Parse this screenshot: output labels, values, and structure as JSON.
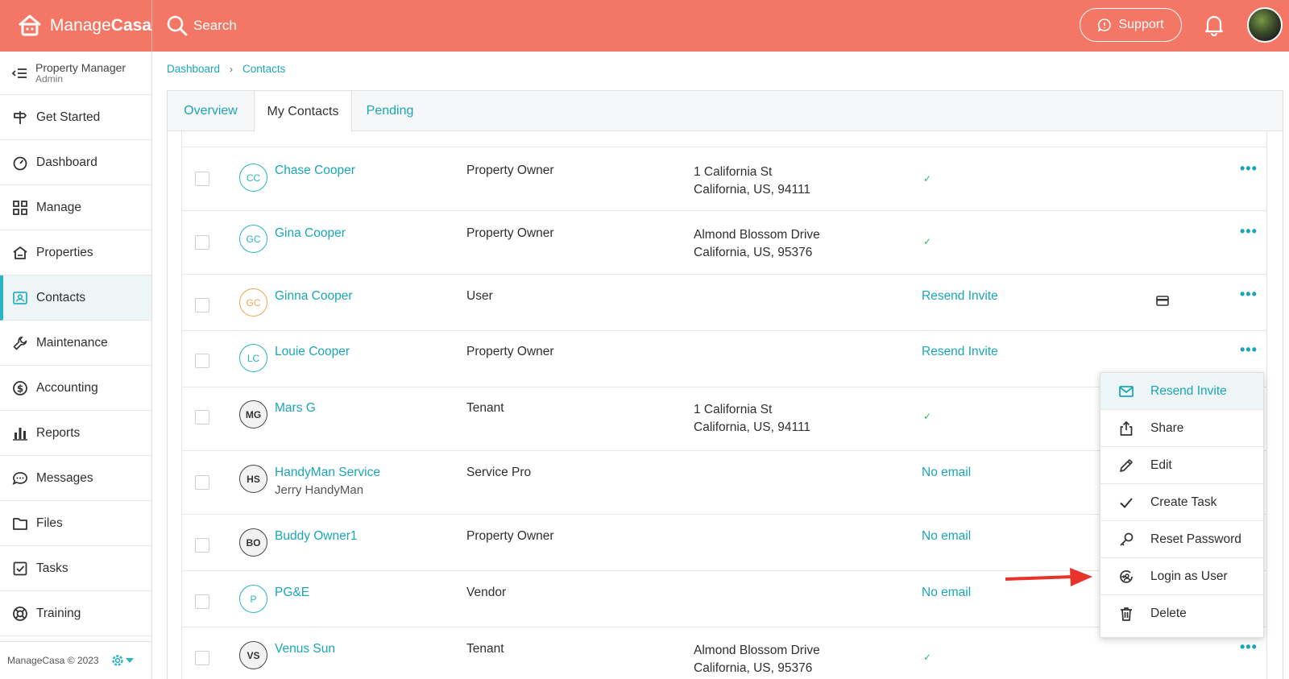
{
  "brand": {
    "name_light": "Manage",
    "name_bold": "Casa"
  },
  "header": {
    "search_label": "Search",
    "support_label": "Support"
  },
  "sidebar": {
    "role": "Property Manager",
    "subrole": "Admin",
    "items": [
      {
        "label": "Get Started",
        "icon": "signpost-icon"
      },
      {
        "label": "Dashboard",
        "icon": "gauge-icon"
      },
      {
        "label": "Manage",
        "icon": "grid-icon"
      },
      {
        "label": "Properties",
        "icon": "house-icon"
      },
      {
        "label": "Contacts",
        "icon": "contact-card-icon",
        "active": true
      },
      {
        "label": "Maintenance",
        "icon": "wrench-icon"
      },
      {
        "label": "Accounting",
        "icon": "dollar-icon"
      },
      {
        "label": "Reports",
        "icon": "bar-chart-icon"
      },
      {
        "label": "Messages",
        "icon": "chat-icon"
      },
      {
        "label": "Files",
        "icon": "folder-icon"
      },
      {
        "label": "Tasks",
        "icon": "checkbox-icon"
      },
      {
        "label": "Training",
        "icon": "lifebuoy-icon"
      }
    ],
    "footer": "ManageCasa © 2023"
  },
  "breadcrumb": {
    "root": "Dashboard",
    "current": "Contacts"
  },
  "tabs": [
    "Overview",
    "My Contacts",
    "Pending"
  ],
  "contacts": [
    {
      "initials": "CC",
      "name": "Chase Cooper",
      "type": "Property Owner",
      "addr1": "1 California St",
      "addr2": "California, US, 94111",
      "status": "✓"
    },
    {
      "initials": "GC",
      "name": "Gina Cooper",
      "type": "Property Owner",
      "addr1": "Almond Blossom Drive",
      "addr2": "California, US, 95376",
      "status": "✓"
    },
    {
      "initials": "GC",
      "name": "Ginna Cooper",
      "type": "User",
      "addr1": "",
      "addr2": "",
      "status": "Resend Invite"
    },
    {
      "initials": "LC",
      "name": "Louie Cooper",
      "type": "Property Owner",
      "addr1": "",
      "addr2": "",
      "status": "Resend Invite"
    },
    {
      "initials": "MG",
      "name": "Mars G",
      "type": "Tenant",
      "addr1": "1 California St",
      "addr2": "California, US, 94111",
      "status": "✓"
    },
    {
      "initials": "HS",
      "name": "HandyMan Service",
      "sub": "Jerry HandyMan",
      "type": "Service Pro",
      "addr1": "",
      "addr2": "",
      "status": "No email"
    },
    {
      "initials": "BO",
      "name": "Buddy Owner1",
      "type": "Property Owner",
      "addr1": "",
      "addr2": "",
      "status": "No email"
    },
    {
      "initials": "P",
      "name": "PG&E",
      "type": "Vendor",
      "addr1": "",
      "addr2": "",
      "status": "No email"
    },
    {
      "initials": "VS",
      "name": "Venus Sun",
      "type": "Tenant",
      "addr1": "Almond Blossom Drive",
      "addr2": "California, US, 95376",
      "status": "✓"
    }
  ],
  "row_menu_label": "•••",
  "context_menu": [
    {
      "label": "Resend Invite",
      "icon": "envelope-icon"
    },
    {
      "label": "Share",
      "icon": "share-icon"
    },
    {
      "label": "Edit",
      "icon": "pencil-icon"
    },
    {
      "label": "Create Task",
      "icon": "check-icon"
    },
    {
      "label": "Reset Password",
      "icon": "key-icon"
    },
    {
      "label": "Login as User",
      "icon": "login-user-icon"
    },
    {
      "label": "Delete",
      "icon": "trash-icon"
    }
  ],
  "colors": {
    "header": "#f47766",
    "accent": "#1aa6b7",
    "annotation_arrow": "#e8332a"
  }
}
